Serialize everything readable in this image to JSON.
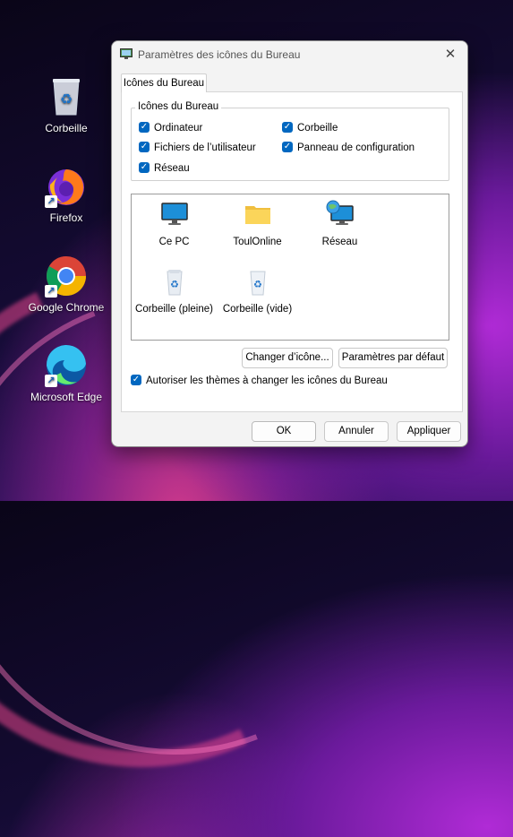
{
  "desktop": {
    "icons": [
      {
        "label": "Corbeille",
        "icon": "recycle-bin-icon"
      },
      {
        "label": "Firefox",
        "icon": "firefox-icon"
      },
      {
        "label": "Google Chrome",
        "icon": "chrome-icon"
      },
      {
        "label": "Microsoft Edge",
        "icon": "edge-icon"
      }
    ]
  },
  "dialog": {
    "title": "Paramètres des icônes du Bureau",
    "close_glyph": "✕",
    "tab_label": "Icônes du Bureau",
    "group_label": "Icônes du Bureau",
    "checkboxes": [
      {
        "label": "Ordinateur",
        "checked": true
      },
      {
        "label": "Corbeille",
        "checked": true
      },
      {
        "label": "Fichiers de l’utilisateur",
        "checked": true
      },
      {
        "label": "Panneau de configuration",
        "checked": true
      },
      {
        "label": "Réseau",
        "checked": true
      }
    ],
    "icon_list": [
      {
        "label": "Ce PC",
        "icon": "monitor-icon"
      },
      {
        "label": "ToulOnline",
        "icon": "folder-icon"
      },
      {
        "label": "Réseau",
        "icon": "network-icon"
      },
      {
        "label": "Corbeille (pleine)",
        "icon": "recycle-bin-full-icon"
      },
      {
        "label": "Corbeille (vide)",
        "icon": "recycle-bin-empty-icon"
      }
    ],
    "change_icon_button": "Changer d’icône...",
    "default_button": "Paramètres par défaut",
    "allow_themes_checkbox": {
      "label": "Autoriser les thèmes à changer les icônes du Bureau",
      "checked": true
    },
    "ok_button": "OK",
    "cancel_button": "Annuler",
    "apply_button": "Appliquer"
  },
  "colors": {
    "accent": "#0067c0"
  }
}
